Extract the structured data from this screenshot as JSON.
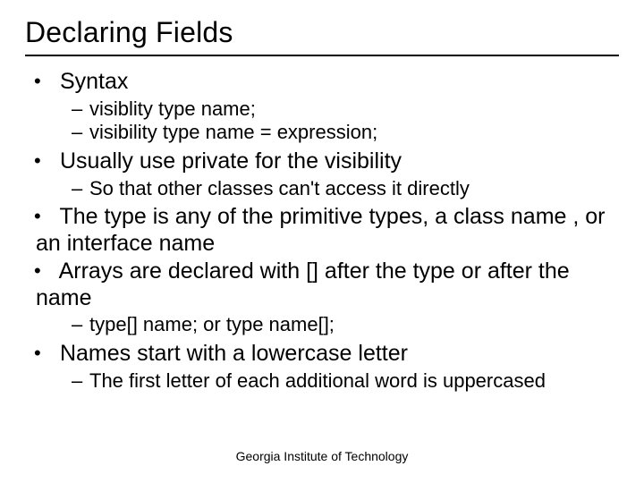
{
  "title": "Declaring Fields",
  "bullets": [
    {
      "text": "Syntax",
      "sub": [
        "visiblity type name;",
        "visibility type name = expression;"
      ]
    },
    {
      "text": "Usually use private for the visibility",
      "sub": [
        "So that other classes can't access it directly"
      ]
    },
    {
      "text": "The type is any of the primitive types, a class name , or an interface name",
      "sub": []
    },
    {
      "text": "Arrays are declared with [] after the type or after the name",
      "sub": [
        "type[] name; or type name[];"
      ]
    },
    {
      "text": "Names start with a lowercase letter",
      "sub": [
        "The first letter of each additional word is uppercased"
      ]
    }
  ],
  "footer": "Georgia Institute of Technology"
}
